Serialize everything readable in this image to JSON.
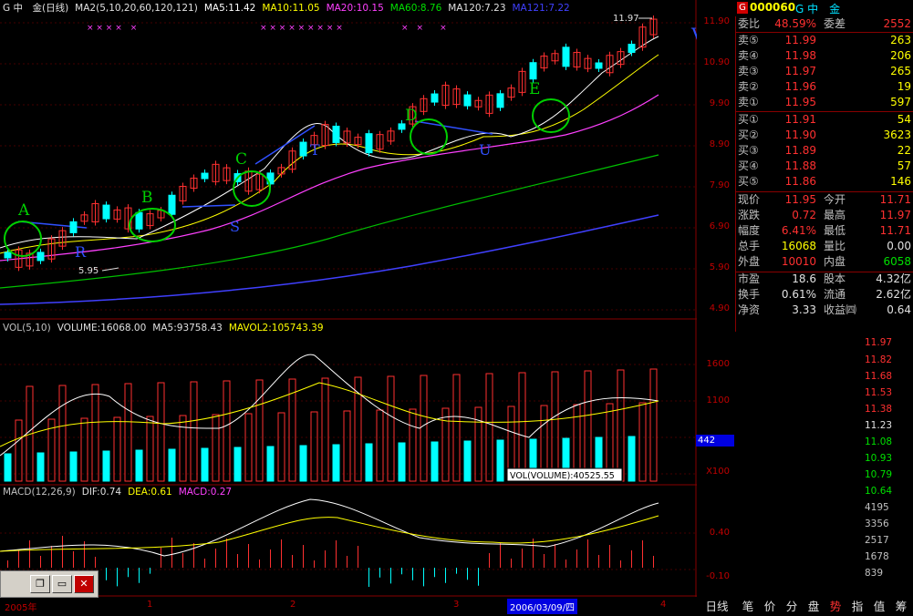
{
  "header": {
    "stock_title": "G 中　金(日线)",
    "ma_group": "MA2(5,10,20,60,120,121)",
    "ma5": "MA5:11.42",
    "ma10": "MA10:11.05",
    "ma20": "MA20:10.15",
    "ma60": "MA60:8.76",
    "ma120": "MA120:7.23",
    "ma121": "MA121:7.22"
  },
  "vol_header": {
    "label": "VOL(5,10)",
    "volume": "VOLUME:16068.00",
    "ma5": "MA5:93758.43",
    "mavol2": "MAVOL2:105743.39"
  },
  "macd_header": {
    "label": "MACD(12,26,9)",
    "dif": "DIF:0.74",
    "dea": "DEA:0.61",
    "macd": "MACD:0.27"
  },
  "chart_annotations": {
    "a": "A",
    "b": "B",
    "c": "C",
    "d": "D",
    "e": "E",
    "r": "R",
    "s": "S",
    "t": "T",
    "u": "U",
    "v": "V",
    "low_label": "5.95",
    "high_label": "11.97",
    "vol_tooltip": "VOL(VOLUME):40525.55"
  },
  "price_axis": [
    "11.90",
    "10.90",
    "9.90",
    "8.90",
    "7.90",
    "6.90",
    "5.90",
    "4.90"
  ],
  "vol_axis": [
    "1600",
    "1100",
    "X100"
  ],
  "vol_marker": "442",
  "macd_axis": [
    "0.40",
    "-0.10"
  ],
  "date_axis": {
    "year": "2005年",
    "m1": "1",
    "m2": "2",
    "m3": "3",
    "m4": "4",
    "cursor": "2006/03/09/四"
  },
  "quote": {
    "code_badge": "G",
    "code": "000060",
    "name": "G 中　金",
    "weibi_label": "委比",
    "weibi": "48.59%",
    "weicha_label": "委差",
    "weicha": "2552",
    "sells": [
      {
        "label": "卖⑤",
        "price": "11.99",
        "vol": "263"
      },
      {
        "label": "卖④",
        "price": "11.98",
        "vol": "206"
      },
      {
        "label": "卖③",
        "price": "11.97",
        "vol": "265"
      },
      {
        "label": "卖②",
        "price": "11.96",
        "vol": "19"
      },
      {
        "label": "卖①",
        "price": "11.95",
        "vol": "597"
      }
    ],
    "buys": [
      {
        "label": "买①",
        "price": "11.91",
        "vol": "54"
      },
      {
        "label": "买②",
        "price": "11.90",
        "vol": "3623"
      },
      {
        "label": "买③",
        "price": "11.89",
        "vol": "22"
      },
      {
        "label": "买④",
        "price": "11.88",
        "vol": "57"
      },
      {
        "label": "买⑤",
        "price": "11.86",
        "vol": "146"
      }
    ],
    "stats": [
      {
        "l1": "现价",
        "v1": "11.95",
        "l2": "今开",
        "v2": "11.71"
      },
      {
        "l1": "涨跌",
        "v1": "0.72",
        "l2": "最高",
        "v2": "11.97"
      },
      {
        "l1": "幅度",
        "v1": "6.41%",
        "l2": "最低",
        "v2": "11.71"
      },
      {
        "l1": "总手",
        "v1": "16068",
        "l2": "量比",
        "v2": "0.00"
      },
      {
        "l1": "外盘",
        "v1": "10010",
        "l2": "内盘",
        "v2": "6058"
      }
    ],
    "finance": [
      {
        "l1": "市盈",
        "v1": "18.6",
        "l2": "股本",
        "v2": "4.32亿"
      },
      {
        "l1": "换手",
        "v1": "0.61%",
        "l2": "流通",
        "v2": "2.62亿"
      },
      {
        "l1": "净资",
        "v1": "3.33",
        "l2": "收益㈣",
        "v2": "0.64"
      }
    ]
  },
  "intraday_axis": [
    "11.97",
    "11.82",
    "11.68",
    "11.53",
    "11.38",
    "11.23",
    "11.08",
    "10.93",
    "10.79",
    "10.64",
    "4195",
    "3356",
    "2517",
    "1678",
    "839"
  ],
  "tabs": [
    "日线",
    "笔",
    "价",
    "分",
    "盘",
    "势",
    "指",
    "值",
    "筹"
  ],
  "colors": {
    "up": "#ff3030",
    "down": "#00ffff",
    "ma5": "#ffffff",
    "ma10": "#ffff00",
    "ma20": "#ff40ff",
    "ma60": "#00c000",
    "ma120": "#4040ff",
    "axis": "#c00000"
  }
}
